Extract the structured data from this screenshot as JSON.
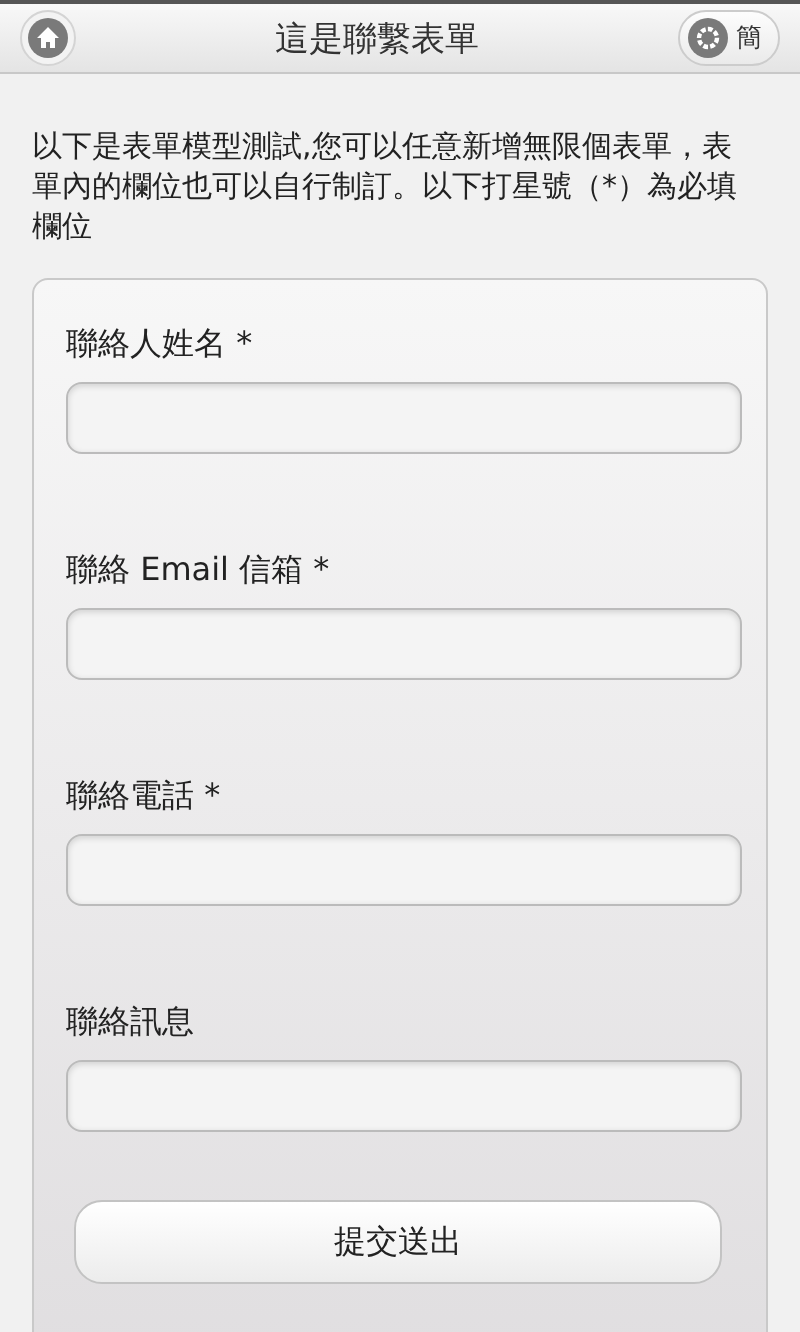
{
  "header": {
    "title": "這是聯繫表單",
    "right_button": "簡"
  },
  "intro": "以下是表單模型測試,您可以任意新增無限個表單，表單內的欄位也可以自行制訂。以下打星號（*）為必填欄位",
  "fields": [
    {
      "label": "聯絡人姓名 *"
    },
    {
      "label": "聯絡 Email 信箱 *"
    },
    {
      "label": "聯絡電話 *"
    },
    {
      "label": "聯絡訊息"
    }
  ],
  "submit": "提交送出"
}
